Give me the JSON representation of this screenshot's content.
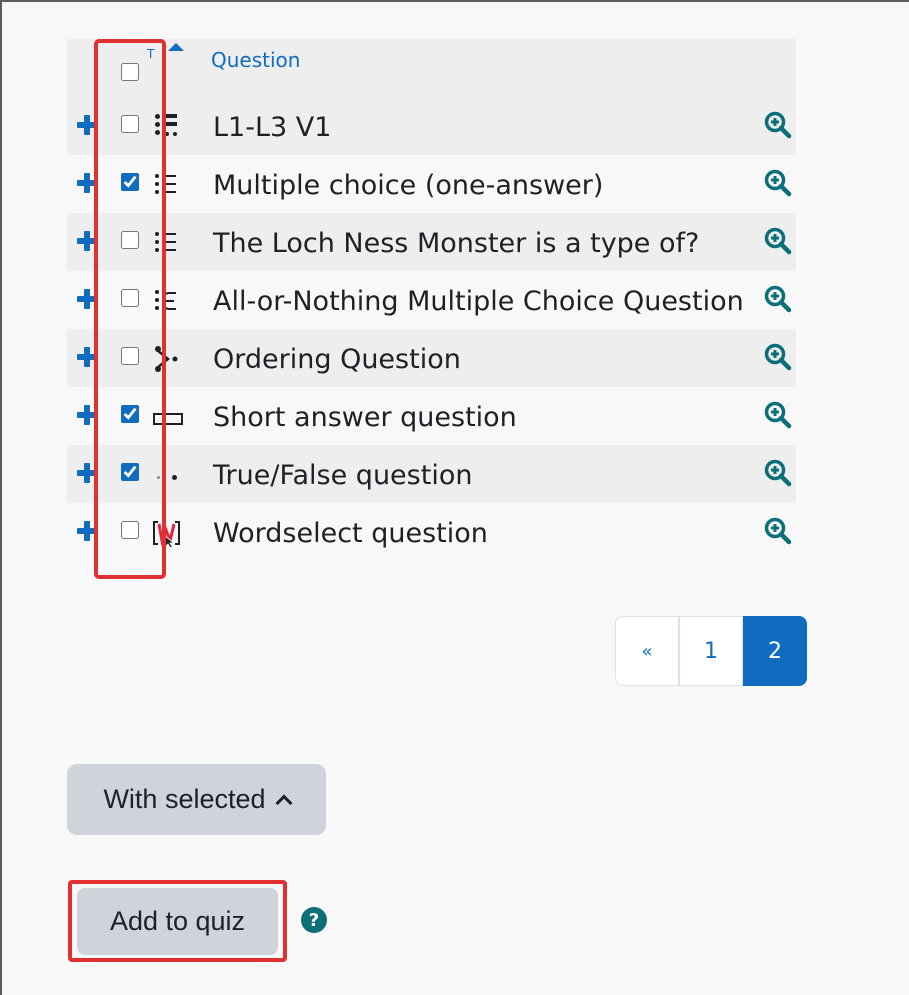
{
  "table": {
    "sort_indicator": "T",
    "question_header": "Question",
    "rows": [
      {
        "name": "L1-L3 V1",
        "type_icon": "calculated-question-icon",
        "checked": false
      },
      {
        "name": "Multiple choice (one-answer)",
        "type_icon": "multichoice-icon",
        "checked": true
      },
      {
        "name": "The Loch Ness Monster is a type of?",
        "type_icon": "multichoice-icon",
        "checked": false
      },
      {
        "name": "All-or-Nothing Multiple Choice Question",
        "type_icon": "all-or-nothing-icon",
        "checked": false
      },
      {
        "name": "Ordering Question",
        "type_icon": "ordering-icon",
        "checked": false
      },
      {
        "name": "Short answer question",
        "type_icon": "short-answer-icon",
        "checked": true
      },
      {
        "name": "True/False question",
        "type_icon": "truefalse-icon",
        "checked": true
      },
      {
        "name": "Wordselect question",
        "type_icon": "wordselect-icon",
        "checked": false
      }
    ]
  },
  "pagination": {
    "prev": "«",
    "pages": [
      "1",
      "2"
    ],
    "current": "2"
  },
  "actions": {
    "with_selected": "With selected",
    "add_to_quiz": "Add to quiz",
    "help": "?"
  },
  "colors": {
    "accent": "#0f6cbf",
    "highlight": "#e03030",
    "button": "#ced4da",
    "help": "#0b6f79"
  }
}
